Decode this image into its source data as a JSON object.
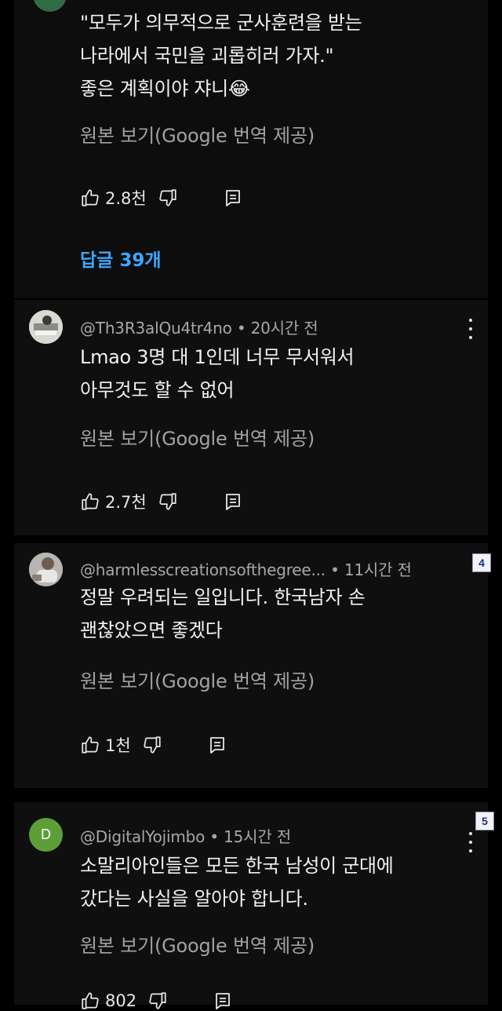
{
  "comment1": {
    "body_lines": [
      "\"모두가 의무적으로 군사훈련을 받는",
      "나라에서 국민을 괴롭히러 가자.\"",
      "좋은 계획이야 쟈니😂"
    ],
    "translate": "원본 보기(Google 번역 제공)",
    "likes": "2.8천",
    "replies": "답글 39개"
  },
  "comment2": {
    "header": "@Th3R3alQu4tr4no • 20시간 전",
    "body_lines": [
      "Lmao 3명 대 1인데 너무 무서워서",
      "아무것도 할 수 없어"
    ],
    "translate": "원본 보기(Google 번역 제공)",
    "likes": "2.7천"
  },
  "comment3": {
    "header": "@harmlesscreationsofthegree... • 11시간 전",
    "body_lines": [
      "정말 우려되는 일입니다. 한국남자 손",
      "괜찮았으면 좋겠다"
    ],
    "translate": "원본 보기(Google 번역 제공)",
    "likes": "1천",
    "badge": "4"
  },
  "comment4": {
    "avatar_letter": "D",
    "header": "@DigitalYojimbo • 15시간 전",
    "body_lines": [
      "소말리아인들은 모든 한국 남성이 군대에",
      "갔다는 사실을 알아야 합니다."
    ],
    "translate": "원본 보기(Google 번역 제공)",
    "likes": "802",
    "badge": "5"
  },
  "icons": {
    "like": "thumbs-up-icon",
    "dislike": "thumbs-down-icon",
    "reply": "reply-comment-icon",
    "more": "more-vertical-icon"
  },
  "colors": {
    "background": "#000000",
    "card": "#0f0f0f",
    "text": "#f1f1f1",
    "secondary_text": "#a7a7a7",
    "link": "#3ea6ff",
    "avatar_d": "#5d9e37"
  }
}
